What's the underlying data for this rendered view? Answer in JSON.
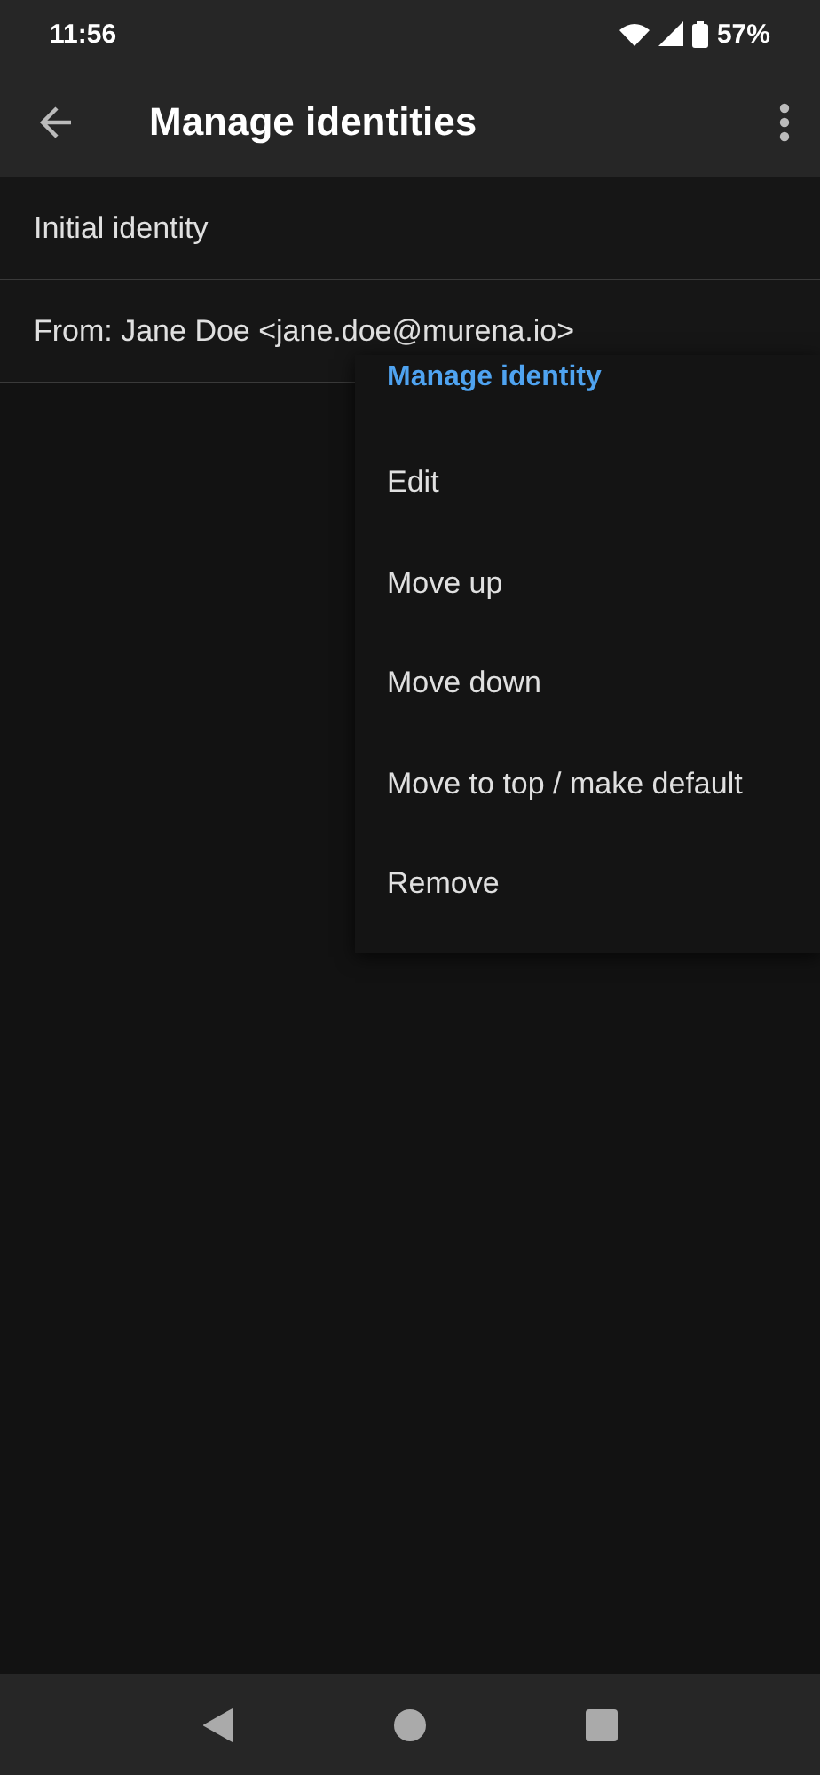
{
  "status_bar": {
    "time": "11:56",
    "battery": "57%"
  },
  "app_bar": {
    "title": "Manage identities"
  },
  "identities": [
    {
      "label": "Initial identity"
    },
    {
      "label": "From: Jane Doe <jane.doe@murena.io>"
    }
  ],
  "menu": [
    {
      "kind": "header",
      "label": "Manage identity"
    },
    {
      "kind": "item",
      "label": "Edit"
    },
    {
      "kind": "item",
      "label": "Move up"
    },
    {
      "kind": "item",
      "label": "Move down"
    },
    {
      "kind": "item",
      "label": "Move to top / make default"
    },
    {
      "kind": "item",
      "label": "Remove"
    }
  ]
}
